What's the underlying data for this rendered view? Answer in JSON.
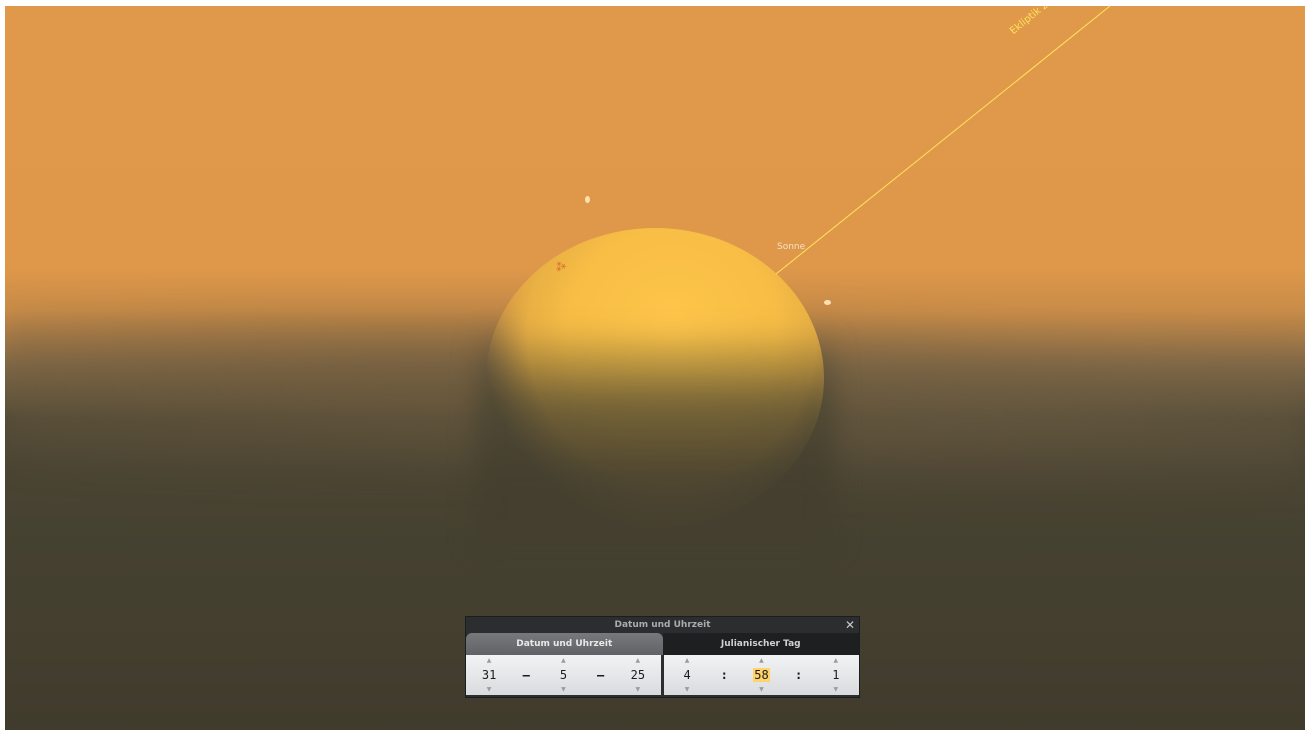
{
  "sky": {
    "ecliptic_label": "Ekliptik zum Datum",
    "sun_label": "Sonne"
  },
  "dialog": {
    "title": "Datum und Uhrzeit",
    "tabs": [
      {
        "label": "Datum und Uhrzeit",
        "active": true
      },
      {
        "label": "Julianischer Tag",
        "active": false
      }
    ],
    "date": {
      "day": "31",
      "month": "5",
      "year": "25",
      "separator": "–"
    },
    "time": {
      "hour": "4",
      "minute": "58",
      "second": "1",
      "separator": ":"
    },
    "highlighted_field": "minute"
  },
  "colors": {
    "sky_top": "#e0994a",
    "ground": "#443f2f",
    "sun": "#ffc64a",
    "ecliptic_line": "#ffe35a",
    "dialog_bg": "#2b2d2f",
    "highlight": "#ffd36a"
  },
  "icons": {
    "close": "close-icon",
    "up": "arrow-up-icon",
    "down": "arrow-down-icon"
  }
}
